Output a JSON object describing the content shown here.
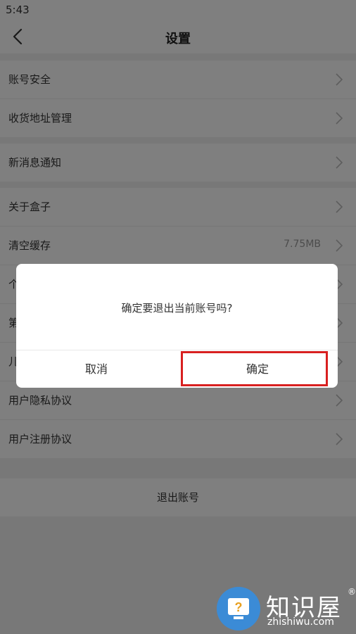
{
  "status_bar": {
    "time": "5:43"
  },
  "nav": {
    "title": "设置"
  },
  "groups": [
    {
      "items": [
        {
          "label": "账号安全"
        },
        {
          "label": "收货地址管理"
        }
      ]
    },
    {
      "items": [
        {
          "label": "新消息通知"
        }
      ]
    },
    {
      "items": [
        {
          "label": "关于盒子"
        },
        {
          "label": "清空缓存",
          "value": "7.75MB"
        },
        {
          "label": "个"
        },
        {
          "label": "第"
        },
        {
          "label": "儿"
        },
        {
          "label": "用户隐私协议"
        },
        {
          "label": "用户注册协议"
        }
      ]
    }
  ],
  "logout": {
    "label": "退出账号"
  },
  "dialog": {
    "message": "确定要退出当前账号吗?",
    "cancel_label": "取消",
    "confirm_label": "确定"
  },
  "watermark": {
    "name": "知识屋",
    "url": "zhishiwu.com",
    "reg": "®"
  }
}
